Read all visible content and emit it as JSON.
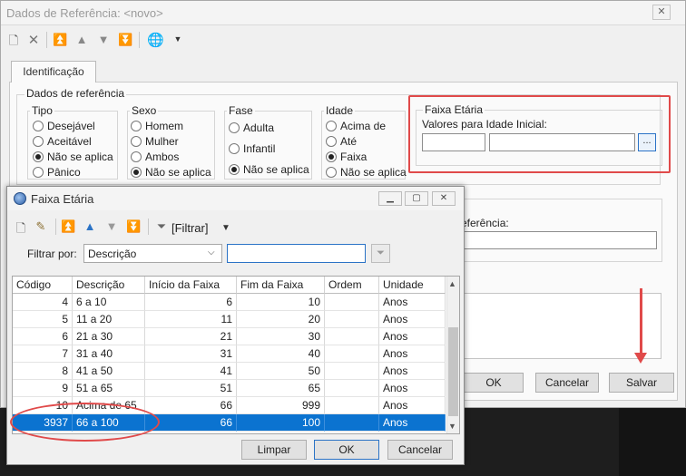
{
  "main_window": {
    "title": "Dados de Referência: <novo>",
    "close": "✕",
    "tab": "Identificação",
    "group_title": "Dados de referência",
    "tipo": {
      "title": "Tipo",
      "options": [
        "Desejável",
        "Aceitável",
        "Não se aplica",
        "Pânico"
      ],
      "selected": 2
    },
    "sexo": {
      "title": "Sexo",
      "options": [
        "Homem",
        "Mulher",
        "Ambos",
        "Não se aplica"
      ],
      "selected": 3
    },
    "fase": {
      "title": "Fase",
      "options": [
        "Adulta",
        "Infantil",
        "Não se aplica"
      ],
      "selected": 2
    },
    "idade": {
      "title": "Idade",
      "options": [
        "Acima de",
        "Até",
        "Faixa",
        "Não se aplica"
      ],
      "selected": 2
    },
    "faixa_etaria": {
      "title": "Faixa Etária",
      "label": "Valores para Idade Inicial:",
      "button": "..."
    },
    "referencia_label": "eferência:",
    "buttons": {
      "ok": "OK",
      "cancel": "Cancelar",
      "save": "Salvar"
    }
  },
  "dialog": {
    "title": "Faixa Etária",
    "filter_label": "[Filtrar]",
    "filter_by_label": "Filtrar por:",
    "filter_field": "Descrição",
    "grid": {
      "columns": [
        "Código",
        "Descrição",
        "Início da Faixa",
        "Fim da Faixa",
        "Ordem",
        "Unidade"
      ],
      "rows": [
        [
          "4",
          "6 a 10",
          "6",
          "10",
          "",
          "Anos"
        ],
        [
          "5",
          "11 a 20",
          "11",
          "20",
          "",
          "Anos"
        ],
        [
          "6",
          "21 a 30",
          "21",
          "30",
          "",
          "Anos"
        ],
        [
          "7",
          "31 a 40",
          "31",
          "40",
          "",
          "Anos"
        ],
        [
          "8",
          "41 a 50",
          "41",
          "50",
          "",
          "Anos"
        ],
        [
          "9",
          "51 a 65",
          "51",
          "65",
          "",
          "Anos"
        ],
        [
          "10",
          "Acima de 65",
          "66",
          "999",
          "",
          "Anos"
        ],
        [
          "3937",
          "66 a 100",
          "66",
          "100",
          "",
          "Anos"
        ]
      ],
      "selected_row": 7
    },
    "buttons": {
      "clear": "Limpar",
      "ok": "OK",
      "cancel": "Cancelar"
    }
  },
  "colors": {
    "selection": "#0b73d0",
    "annotation": "#e04a4a",
    "focus_border": "#2b73c6"
  }
}
